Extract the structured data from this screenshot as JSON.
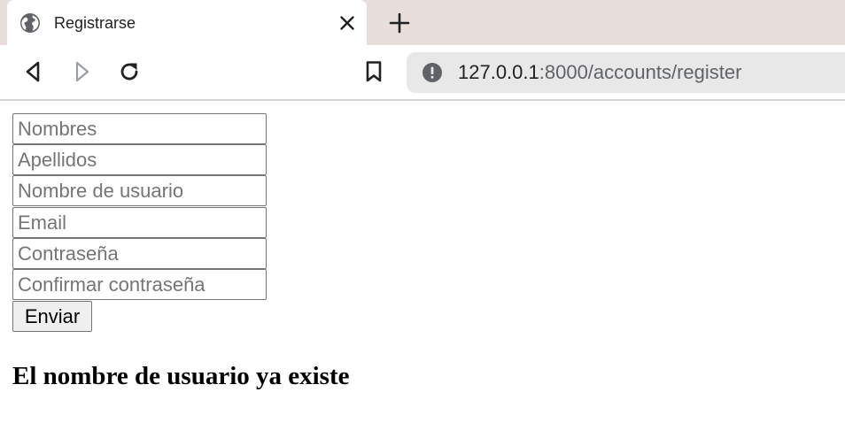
{
  "tab": {
    "title": "Registrarse",
    "favicon": "globe-icon",
    "close_icon": "close-icon",
    "new_tab_icon": "plus-icon"
  },
  "toolbar": {
    "back_icon": "back-icon",
    "forward_icon": "forward-icon",
    "reload_icon": "reload-icon",
    "bookmark_icon": "bookmark-icon",
    "info_icon": "info-icon",
    "url_host": "127.0.0.1",
    "url_path": ":8000/accounts/register"
  },
  "form": {
    "fields": [
      {
        "placeholder": "Nombres",
        "value": ""
      },
      {
        "placeholder": "Apellidos",
        "value": ""
      },
      {
        "placeholder": "Nombre de usuario",
        "value": ""
      },
      {
        "placeholder": "Email",
        "value": ""
      },
      {
        "placeholder": "Contraseña",
        "value": ""
      },
      {
        "placeholder": "Confirmar contraseña",
        "value": ""
      }
    ],
    "submit_label": "Enviar"
  },
  "message": "El nombre de usuario ya existe",
  "colors": {
    "tabstrip_bg": "#e8dfdc",
    "omnibox_bg": "#e8e8e8",
    "url_path": "#5f6368",
    "button_bg": "#efefef"
  }
}
